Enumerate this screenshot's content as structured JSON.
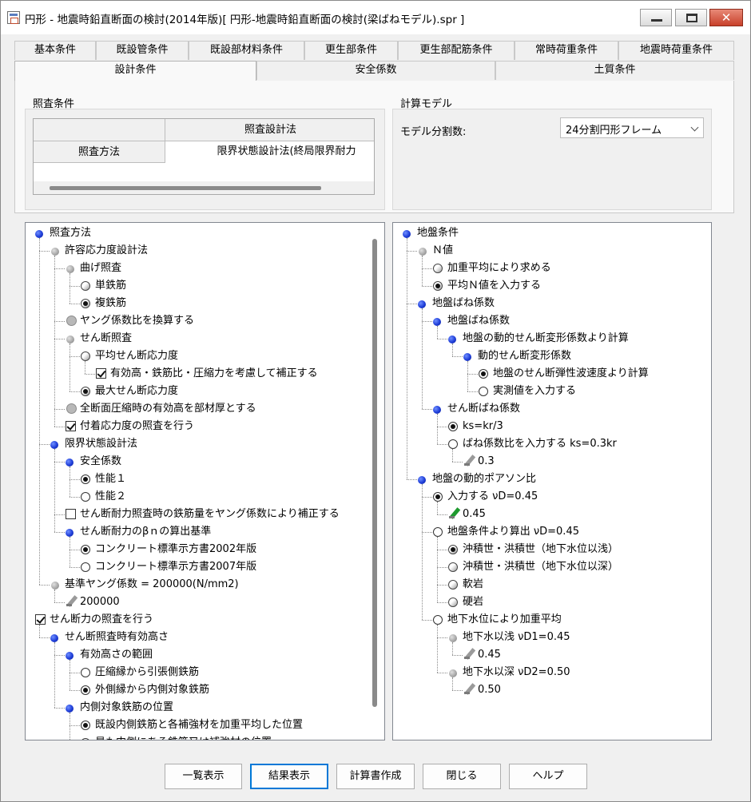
{
  "window": {
    "title": "円形 - 地震時鉛直断面の検討(2014年版)[ 円形-地震時鉛直断面の検討(梁ばねモデル).spr ]",
    "controls": {
      "minimize": "▁",
      "maximize": "□",
      "close": "✕"
    }
  },
  "tabs": {
    "row1": [
      "基本条件",
      "既設管条件",
      "既設部材料条件",
      "更生部条件",
      "更生部配筋条件",
      "常時荷重条件",
      "地震時荷重条件"
    ],
    "row2": [
      "設計条件",
      "安全係数",
      "土質条件"
    ],
    "active": "設計条件"
  },
  "check_conditions": {
    "group_title": "照査条件",
    "grid": {
      "header": "照査設計法",
      "row_label": "照査方法",
      "row_value": "限界状態設計法(終局限界耐力"
    }
  },
  "calc_model": {
    "group_title": "計算モデル",
    "label": "モデル分割数:",
    "value": "24分割円形フレーム"
  },
  "left_tree": [
    {
      "text": "照査方法",
      "icon": "blue"
    },
    {
      "text": "許容応力度設計法",
      "icon": "gray"
    },
    {
      "text": "曲げ照査",
      "icon": "gray"
    },
    {
      "text": "単鉄筋",
      "icon": "radio-dim"
    },
    {
      "text": "複鉄筋",
      "icon": "radio-dim-on"
    },
    {
      "text": "ヤング係数比を換算する",
      "icon": "check-gray"
    },
    {
      "text": "せん断照査",
      "icon": "gray"
    },
    {
      "text": "平均せん断応力度",
      "icon": "radio-dim"
    },
    {
      "text": "有効高・鉄筋比・圧縮力を考慮して補正する",
      "icon": "check-on"
    },
    {
      "text": "最大せん断応力度",
      "icon": "radio-dim-on"
    },
    {
      "text": "全断面圧縮時の有効高を部材厚とする",
      "icon": "check-gray"
    },
    {
      "text": "付着応力度の照査を行う",
      "icon": "check-on"
    },
    {
      "text": "限界状態設計法",
      "icon": "blue"
    },
    {
      "text": "安全係数",
      "icon": "blue"
    },
    {
      "text": "性能１",
      "icon": "radio-on"
    },
    {
      "text": "性能２",
      "icon": "radio"
    },
    {
      "text": "せん断耐力照査時の鉄筋量をヤング係数により補正する",
      "icon": "check"
    },
    {
      "text": "せん断耐力のβｎの算出基準",
      "icon": "blue"
    },
    {
      "text": "コンクリート標準示方書2002年版",
      "icon": "radio-on"
    },
    {
      "text": "コンクリート標準示方書2007年版",
      "icon": "radio"
    },
    {
      "text": "基準ヤング係数 = 200000(N/mm2)",
      "icon": "gray"
    },
    {
      "text": "200000",
      "icon": "pen"
    },
    {
      "text": "せん断力の照査を行う",
      "icon": "check-on"
    },
    {
      "text": "せん断照査時有効高さ",
      "icon": "blue"
    },
    {
      "text": "有効高さの範囲",
      "icon": "blue"
    },
    {
      "text": "圧縮縁から引張側鉄筋",
      "icon": "radio"
    },
    {
      "text": "外側縁から内側対象鉄筋",
      "icon": "radio-on"
    },
    {
      "text": "内側対象鉄筋の位置",
      "icon": "blue"
    },
    {
      "text": "既設内側鉄筋と各補強材を加重平均した位置",
      "icon": "radio-on"
    },
    {
      "text": "最も内側にある鉄筋又は補強材の位置",
      "icon": "radio"
    }
  ],
  "right_tree": [
    {
      "text": "地盤条件",
      "icon": "blue"
    },
    {
      "text": "Ｎ値",
      "icon": "gray"
    },
    {
      "text": "加重平均により求める",
      "icon": "radio-dim"
    },
    {
      "text": "平均Ｎ値を入力する",
      "icon": "radio-dim-on"
    },
    {
      "text": "地盤ばね係数",
      "icon": "blue"
    },
    {
      "text": "地盤ばね係数",
      "icon": "blue"
    },
    {
      "text": "地盤の動的せん断変形係数より計算",
      "icon": "blue"
    },
    {
      "text": "動的せん断変形係数",
      "icon": "blue"
    },
    {
      "text": "地盤のせん断弾性波速度より計算",
      "icon": "radio-on"
    },
    {
      "text": "実測値を入力する",
      "icon": "radio"
    },
    {
      "text": "せん断ばね係数",
      "icon": "blue"
    },
    {
      "text": "ks=kr/3",
      "icon": "radio-on"
    },
    {
      "text": "ばね係数比を入力する ks=0.3kr",
      "icon": "radio"
    },
    {
      "text": "0.3",
      "icon": "pen"
    },
    {
      "text": "地盤の動的ポアソン比",
      "icon": "blue"
    },
    {
      "text": "入力する νD=0.45",
      "icon": "radio-on"
    },
    {
      "text": "0.45",
      "icon": "pen-green"
    },
    {
      "text": "地盤条件より算出 νD=0.45",
      "icon": "radio"
    },
    {
      "text": "沖積世・洪積世（地下水位以浅）",
      "icon": "radio-dim-on"
    },
    {
      "text": "沖積世・洪積世（地下水位以深）",
      "icon": "radio-dim"
    },
    {
      "text": "軟岩",
      "icon": "radio-dim"
    },
    {
      "text": "硬岩",
      "icon": "radio-dim"
    },
    {
      "text": "地下水位により加重平均",
      "icon": "radio"
    },
    {
      "text": "地下水以浅 νD1=0.45",
      "icon": "gray"
    },
    {
      "text": "0.45",
      "icon": "pen"
    },
    {
      "text": "地下水以深 νD2=0.50",
      "icon": "gray"
    },
    {
      "text": "0.50",
      "icon": "pen"
    }
  ],
  "buttons": [
    "一覧表示",
    "結果表示",
    "計算書作成",
    "閉じる",
    "ヘルプ"
  ],
  "default_button": "結果表示"
}
